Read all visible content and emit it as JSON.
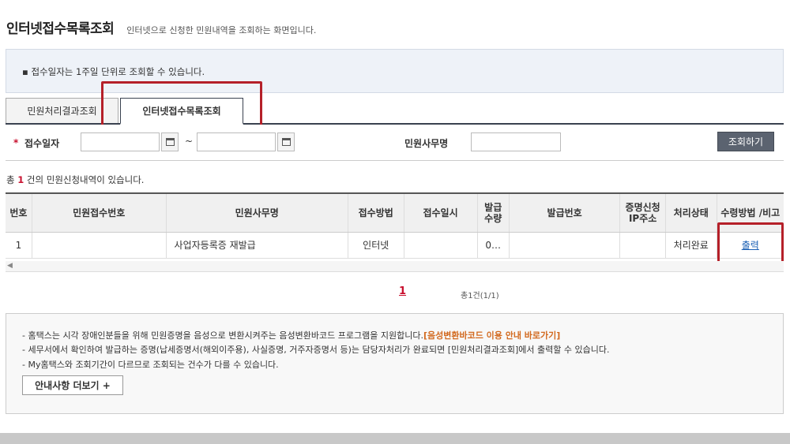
{
  "header": {
    "title": "인터넷접수목록조회",
    "description": "인터넷으로 신청한 민원내역을 조회하는 화면입니다."
  },
  "notice": {
    "text": "▪ 접수일자는 1주일 단위로 조회할 수 있습니다."
  },
  "tabs": [
    {
      "label": "민원처리결과조회",
      "active": false
    },
    {
      "label": "인터넷접수목록조회",
      "active": true
    }
  ],
  "search": {
    "required_mark": "*",
    "date_label": "접수일자",
    "date_from": "",
    "date_to": "",
    "tilde": "~",
    "name_label": "민원사무명",
    "name_value": "",
    "button_label": "조회하기"
  },
  "count": {
    "prefix": "총 ",
    "number": "1",
    "suffix": " 건의 민원신청내역이 있습니다."
  },
  "table": {
    "headers": [
      "번호",
      "민원접수번호",
      "민원사무명",
      "접수방법",
      "접수일시",
      "발급 수량",
      "발급번호",
      "증명신청 IP주소",
      "처리상태",
      "수령방법 /비고"
    ],
    "rows": [
      {
        "no": "1",
        "receipt_no": "",
        "name": "사업자등록증 재발급",
        "method": "인터넷",
        "date": "",
        "qty": "0…",
        "issue_no": "",
        "ip": "",
        "status": "처리완료",
        "action": "출력"
      }
    ]
  },
  "pagination": {
    "current": "1",
    "total_text": "총1건(1/1)"
  },
  "info": {
    "line1": "- 홈택스는 시각 장애인분들을 위해 민원증명을 음성으로 변환시켜주는 음성변환바코드 프로그램을 지원합니다.",
    "line1_link": "[음성변환바코드 이용 안내 바로가기]",
    "line2": "- 세무서에서 확인하여 발급하는 증명(납세증명서(해외이주용), 사실증명, 거주자증명서 등)는 담당자처리가 완료되면 [민원처리결과조회]에서 출력할 수 있습니다.",
    "line3": "- My홈택스와 조회기간이 다르므로 조회되는 건수가 다를 수 있습니다.",
    "more_button": "안내사항 더보기 +"
  },
  "colors": {
    "accent_red": "#c8102e",
    "highlight_box": "#b52029",
    "search_button": "#5b6370",
    "link_blue": "#1a5fb4",
    "link_orange": "#d2691e"
  }
}
